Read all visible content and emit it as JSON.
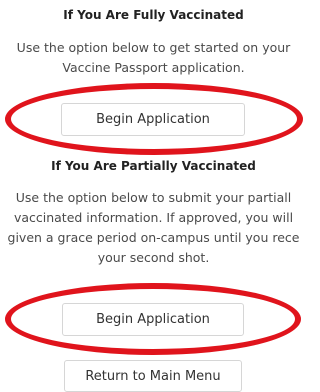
{
  "sections": [
    {
      "heading": "If You Are Fully Vaccinated",
      "description_lines": [
        "Use the option below to get started on your",
        "Vaccine Passport application."
      ],
      "button_label": "Begin Application"
    },
    {
      "heading": "If You Are Partially Vaccinated",
      "description_lines": [
        "Use the option below to submit your partiall",
        "vaccinated information. If approved, you will",
        "given a grace period on-campus until you rece",
        "your second shot."
      ],
      "button_label": "Begin Application"
    }
  ],
  "return_button_label": "Return to Main Menu",
  "annotation_color": "#e0141c"
}
